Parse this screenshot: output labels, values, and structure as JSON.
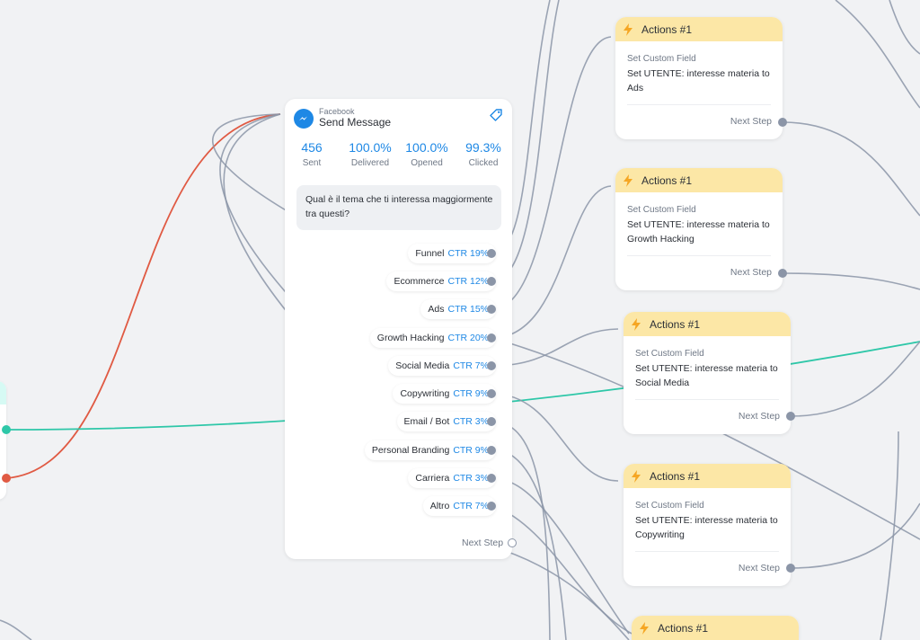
{
  "message_node": {
    "platform": "Facebook",
    "title": "Send Message",
    "stats": [
      {
        "value": "456",
        "label": "Sent"
      },
      {
        "value": "100.0%",
        "label": "Delivered"
      },
      {
        "value": "100.0%",
        "label": "Opened"
      },
      {
        "value": "99.3%",
        "label": "Clicked"
      }
    ],
    "text": "Qual è il tema che ti interessa maggiormente tra questi?",
    "buttons": [
      {
        "label": "Funnel",
        "ctr": "CTR 19%"
      },
      {
        "label": "Ecommerce",
        "ctr": "CTR 12%"
      },
      {
        "label": "Ads",
        "ctr": "CTR 15%"
      },
      {
        "label": "Growth Hacking",
        "ctr": "CTR 20%"
      },
      {
        "label": "Social Media",
        "ctr": "CTR 7%"
      },
      {
        "label": "Copywriting",
        "ctr": "CTR 9%"
      },
      {
        "label": "Email / Bot",
        "ctr": "CTR 3%"
      },
      {
        "label": "Personal Branding",
        "ctr": "CTR 9%"
      },
      {
        "label": "Carriera",
        "ctr": "CTR 3%"
      },
      {
        "label": "Altro",
        "ctr": "CTR 7%"
      }
    ],
    "next_step": "Next Step",
    "icons": {
      "platform": "messenger-icon",
      "tag": "tag-icon"
    }
  },
  "action_nodes": [
    {
      "title": "Actions #1",
      "subtitle": "Set Custom Field",
      "description": "Set UTENTE: interesse materia to Ads",
      "next_step": "Next Step"
    },
    {
      "title": "Actions #1",
      "subtitle": "Set Custom Field",
      "description": "Set UTENTE: interesse materia to Growth Hacking",
      "next_step": "Next Step"
    },
    {
      "title": "Actions #1",
      "subtitle": "Set Custom Field",
      "description": "Set UTENTE: interesse materia to Social Media",
      "next_step": "Next Step"
    },
    {
      "title": "Actions #1",
      "subtitle": "Set Custom Field",
      "description": "Set UTENTE: interesse materia to Copywriting",
      "next_step": "Next Step"
    },
    {
      "title": "Actions #1"
    }
  ],
  "colors": {
    "canvas": "#f1f2f4",
    "accent_blue": "#1e88e5",
    "action_header": "#fce7a6",
    "connector_gray": "#8b95a7",
    "connector_red": "#e05a43",
    "connector_teal": "#2ec7a8"
  }
}
